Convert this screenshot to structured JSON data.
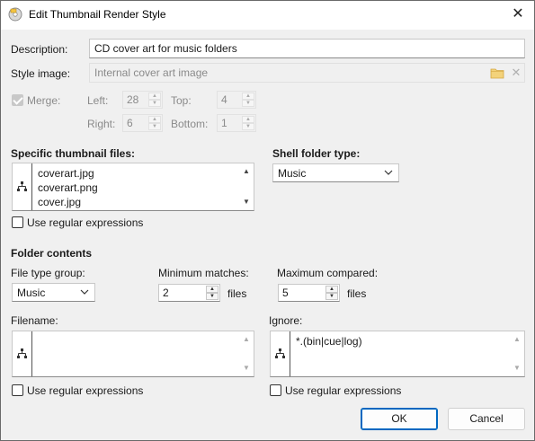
{
  "window": {
    "title": "Edit Thumbnail Render Style",
    "close_label": "✕"
  },
  "description": {
    "label": "Description:",
    "value": "CD cover art for music folders"
  },
  "style_image": {
    "label": "Style image:",
    "value": "Internal cover art image"
  },
  "merge": {
    "label": "Merge:",
    "checked": true,
    "left_label": "Left:",
    "left_value": "28",
    "top_label": "Top:",
    "top_value": "4",
    "right_label": "Right:",
    "right_value": "6",
    "bottom_label": "Bottom:",
    "bottom_value": "1"
  },
  "specific_files": {
    "label": "Specific thumbnail files:",
    "items": [
      "coverart.jpg",
      "coverart.png",
      "cover.jpg"
    ],
    "regex_label": "Use regular expressions"
  },
  "shell_folder": {
    "label": "Shell folder type:",
    "value": "Music"
  },
  "folder_contents": {
    "heading": "Folder contents",
    "file_type_group_label": "File type group:",
    "file_type_group_value": "Music",
    "min_matches_label": "Minimum matches:",
    "min_matches_value": "2",
    "min_matches_unit": "files",
    "max_compared_label": "Maximum compared:",
    "max_compared_value": "5",
    "max_compared_unit": "files"
  },
  "filename": {
    "label": "Filename:",
    "value": "",
    "regex_label": "Use regular expressions"
  },
  "ignore": {
    "label": "Ignore:",
    "value": "*.(bin|cue|log)",
    "regex_label": "Use regular expressions"
  },
  "buttons": {
    "ok": "OK",
    "cancel": "Cancel"
  },
  "colors": {
    "accent": "#0067c0",
    "folder_icon": "#e8b84a"
  }
}
